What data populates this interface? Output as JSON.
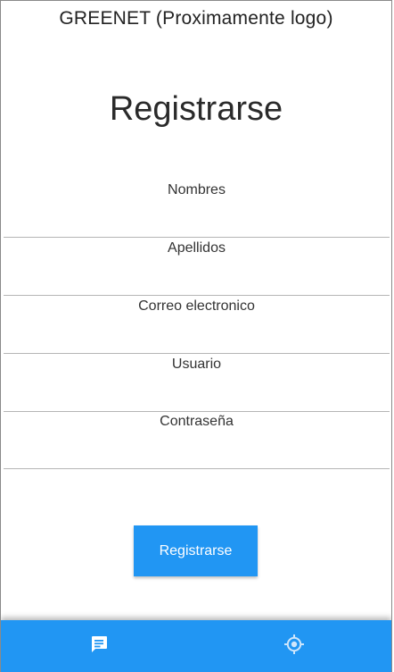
{
  "header": {
    "brand_text": "GREENET (Proximamente logo)"
  },
  "form": {
    "title": "Registrarse",
    "fields": [
      {
        "label": "Nombres",
        "value": "",
        "placeholder": ""
      },
      {
        "label": "Apellidos",
        "value": "",
        "placeholder": ""
      },
      {
        "label": "Correo electronico",
        "value": "",
        "placeholder": ""
      },
      {
        "label": "Usuario",
        "value": "",
        "placeholder": ""
      },
      {
        "label": "Contraseña",
        "value": "",
        "placeholder": ""
      }
    ],
    "submit_label": "Registrarse"
  },
  "bottom_nav": {
    "items": [
      {
        "icon": "chat-message-icon",
        "active": true
      },
      {
        "icon": "location-target-icon",
        "active": false
      }
    ]
  },
  "colors": {
    "primary": "#2196f3",
    "nav_icon_active": "#ffffff",
    "nav_icon_inactive": "#cfe6fb",
    "text": "#222222",
    "divider": "#b5b5b5"
  }
}
